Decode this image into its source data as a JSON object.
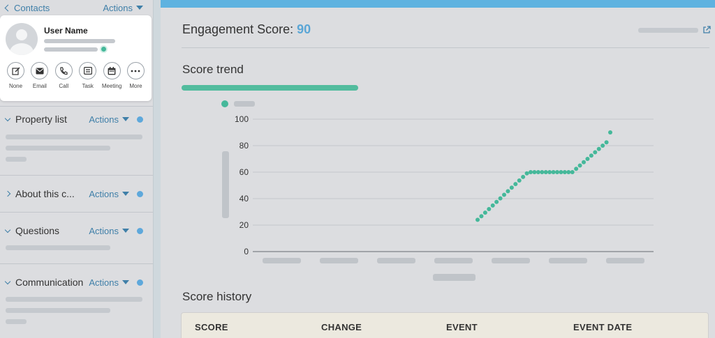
{
  "nav": {
    "back_label": "Contacts",
    "actions_label": "Actions"
  },
  "contact": {
    "name": "User Name"
  },
  "quick_actions": [
    {
      "label": "None",
      "icon": "edit-icon"
    },
    {
      "label": "Email",
      "icon": "mail-icon"
    },
    {
      "label": "Call",
      "icon": "phone-icon"
    },
    {
      "label": "Task",
      "icon": "task-icon"
    },
    {
      "label": "Meeting",
      "icon": "calendar-icon"
    },
    {
      "label": "More",
      "icon": "more-icon"
    }
  ],
  "sections": [
    {
      "title": "Property list",
      "actions_label": "Actions",
      "expanded": true
    },
    {
      "title": "About this c...",
      "actions_label": "Actions",
      "expanded": false
    },
    {
      "title": "Questions",
      "actions_label": "Actions",
      "expanded": true
    },
    {
      "title": "Communication",
      "actions_label": "Actions",
      "expanded": true
    }
  ],
  "engagement": {
    "label": "Engagement Score:",
    "score": "90"
  },
  "trend": {
    "title": "Score trend"
  },
  "chart_data": {
    "type": "line",
    "title": "",
    "xlabel": "",
    "ylabel": "",
    "ylim": [
      0,
      100
    ],
    "y_ticks": [
      "0",
      "20",
      "40",
      "60",
      "80",
      "100"
    ],
    "grid": true,
    "legend": "top-left",
    "series": [
      {
        "color": "#45b89a",
        "x": [
          0,
          1,
          2,
          3,
          4,
          5,
          6,
          7,
          8,
          9,
          10,
          11,
          12,
          13,
          14,
          15,
          16,
          17,
          18,
          19,
          20,
          21,
          22,
          23,
          24,
          25,
          26,
          27,
          28,
          29,
          30,
          31,
          32,
          33,
          34,
          35
        ],
        "values": [
          24,
          26.7,
          29.4,
          32.1,
          34.8,
          37.5,
          40.2,
          42.9,
          45.6,
          48.3,
          51,
          53.7,
          56.4,
          59.1,
          60,
          60,
          60,
          60,
          60,
          60,
          60,
          60,
          60,
          60,
          60,
          60,
          62.5,
          65,
          67.5,
          70,
          72.5,
          75,
          77.5,
          80,
          82.5,
          90
        ]
      }
    ]
  },
  "history": {
    "title": "Score history",
    "columns": [
      "SCORE",
      "CHANGE",
      "EVENT",
      "EVENT DATE"
    ]
  },
  "colors": {
    "accent": "#5eb2e0",
    "series": "#45b89a",
    "link": "#3f7fa8"
  }
}
